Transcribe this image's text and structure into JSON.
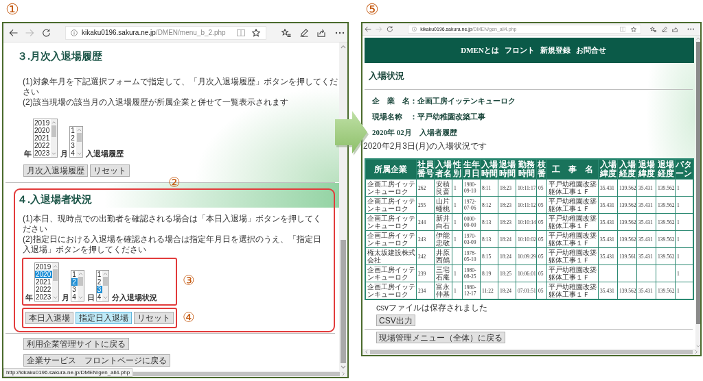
{
  "left_panel": {
    "marker": "①",
    "browser": {
      "nav_buttons": [
        {
          "kind": "back",
          "disabled": false
        },
        {
          "kind": "forward",
          "disabled": true
        },
        {
          "kind": "refresh",
          "disabled": false
        }
      ],
      "address": {
        "host": "kikaku0196.sakura.ne.jp",
        "path": "/DMEN/menu_b_2.php"
      },
      "status_url": "http://kikaku0196.sakura.ne.jp/DMEN/gen_all4.php"
    },
    "section_monthly": {
      "heading": "３.月次入退場履歴",
      "instructions": [
        "(1)対象年月を下記選択フォームで指定して、「月次入退場履歴」ボタンを押してください",
        "(2)該当現場の該当月の入退場履歴が所属企業と併せて一覧表示されます"
      ],
      "pickers": [
        {
          "label": "年",
          "options": [
            {
              "text": "2019",
              "selected": false
            },
            {
              "text": "2020",
              "selected": false
            },
            {
              "text": "2021",
              "selected": false
            },
            {
              "text": "2022",
              "selected": false
            },
            {
              "text": "2023",
              "selected": false
            }
          ]
        },
        {
          "label": "月",
          "options": [
            {
              "text": "1",
              "selected": false
            },
            {
              "text": "2",
              "selected": false
            },
            {
              "text": "3",
              "selected": false
            },
            {
              "text": "4",
              "selected": false
            }
          ]
        }
      ],
      "trailing_label": "入退場履歴",
      "buttons": [
        {
          "label": "月次入退場履歴",
          "hovered": false
        },
        {
          "label": "リセット",
          "hovered": false
        }
      ]
    },
    "section_marker": "②",
    "section_attendance": {
      "heading": "４.入退場者状況",
      "instructions": [
        "(1)本日、現時点での出勤者を確認される場合は「本日入退場」ボタンを押してください",
        "(2)指定日における入退場を確認される場合は指定年月日を選択のうえ、「指定日入退場」ボタンを押してください"
      ],
      "picker_marker": "③",
      "pickers": [
        {
          "label": "年",
          "options": [
            {
              "text": "2019",
              "selected": false
            },
            {
              "text": "2020",
              "selected": true
            },
            {
              "text": "2021",
              "selected": false
            },
            {
              "text": "2022",
              "selected": false
            },
            {
              "text": "2023",
              "selected": false
            }
          ]
        },
        {
          "label": "月",
          "options": [
            {
              "text": "1",
              "selected": false
            },
            {
              "text": "2",
              "selected": true
            },
            {
              "text": "3",
              "selected": false
            },
            {
              "text": "4",
              "selected": false
            }
          ]
        },
        {
          "label": "日",
          "options": [
            {
              "text": "1",
              "selected": false
            },
            {
              "text": "2",
              "selected": false
            },
            {
              "text": "3",
              "selected": true
            },
            {
              "text": "4",
              "selected": false
            }
          ]
        }
      ],
      "trailing_label": "分入退場状況",
      "button_marker": "④",
      "buttons": [
        {
          "label": "本日入退場",
          "hovered": false
        },
        {
          "label": "指定日入退場",
          "hovered": true
        },
        {
          "label": "リセット",
          "hovered": false
        }
      ]
    },
    "footer_buttons": [
      "利用企業管理サイトに戻る",
      "企業サービス　フロントページに戻る"
    ]
  },
  "right_panel": {
    "marker": "⑤",
    "browser": {
      "nav_buttons": [
        {
          "kind": "back",
          "disabled": false
        },
        {
          "kind": "forward",
          "disabled": true
        },
        {
          "kind": "refresh",
          "disabled": false
        }
      ],
      "address": {
        "host": "kikaku0196.sakura.ne.jp",
        "path": "/DMEN/gen_all4.php"
      }
    },
    "site_nav": [
      "DMENとは",
      "フロント",
      "新規登録",
      "お問合せ"
    ],
    "heading": "入場状況",
    "company_line": "企　業　名：企画工房イッテンキューロク",
    "site_line": "現場名称　：平戸幼稚園改築工事",
    "period_heading": "2020年 02月　入場者履歴",
    "date_note": "2020年2月3日(月)の入場状況です",
    "table": {
      "columns": [
        {
          "label": "所属企業",
          "kind": "text"
        },
        {
          "label": "社員番号",
          "kind": "number"
        },
        {
          "label": "入場者名",
          "kind": "text"
        },
        {
          "label": "性別",
          "kind": "number"
        },
        {
          "label": "生年月日",
          "kind": "number"
        },
        {
          "label": "入場時間",
          "kind": "number"
        },
        {
          "label": "退場時間",
          "kind": "number"
        },
        {
          "label": "勤務時間",
          "kind": "number"
        },
        {
          "label": "枝番",
          "kind": "number"
        },
        {
          "label": "工　事　名",
          "kind": "text"
        },
        {
          "label": "入場緯度",
          "kind": "number"
        },
        {
          "label": "入場経度",
          "kind": "number"
        },
        {
          "label": "退場緯度",
          "kind": "number"
        },
        {
          "label": "退場経度",
          "kind": "number"
        },
        {
          "label": "パターン",
          "kind": "number"
        }
      ],
      "rows": [
        [
          "企画工房イッテンキューロク",
          "262",
          "安積艮斎",
          "1",
          "1980-09-10",
          "8:11",
          "18:23",
          "10:11:17",
          "05",
          "平戸幼稚園改築躯体工事１Ｆ",
          "35.431",
          "139.562",
          "35.431",
          "139.562",
          "1"
        ],
        [
          "企画工房イッテンキューロク",
          "255",
          "山片蟠桃",
          "1",
          "1972-07-06",
          "8:12",
          "18:23",
          "10:11:12",
          "05",
          "平戸幼稚園改築躯体工事１Ｆ",
          "35.431",
          "139.562",
          "35.431",
          "139.562",
          "1"
        ],
        [
          "企画工房イッテンキューロク",
          "244",
          "新井白石",
          "1",
          "0000-00-00",
          "8:13",
          "18:23",
          "10:10:14",
          "05",
          "平戸幼稚園改築躯体工事１Ｆ",
          "35.431",
          "139.562",
          "35.431",
          "139.562",
          "1"
        ],
        [
          "企画工房イッテンキューロク",
          "243",
          "伊能忠敬",
          "1",
          "1970-03-09",
          "8:13",
          "18:24",
          "10:10:02",
          "05",
          "平戸幼稚園改築躯体工事１Ｆ",
          "35.431",
          "139.562",
          "35.431",
          "139.562",
          "1"
        ],
        [
          "権太坂建設株式会社",
          "242",
          "井原西鶴",
          null,
          "1978-05-10",
          "8:15",
          "18:24",
          "10:09:29",
          "05",
          "平戸幼稚園改築躯体工事１Ｆ",
          "35.431",
          "139.561",
          "35.431",
          "139.562",
          "1"
        ],
        [
          "企画工房イッテンキューロク",
          "239",
          "三宅石庵",
          "1",
          "1980-08-25",
          "8:19",
          "18:25",
          "10:06:01",
          "05",
          "平戸幼稚園改築躯体工事１Ｆ",
          null,
          null,
          null,
          null,
          "1"
        ],
        [
          "企画工房イッテンキューロク",
          "234",
          "富永仲基",
          "1",
          "1980-12-17",
          "11:22",
          "18:24",
          "07:01:51",
          "05",
          "平戸幼稚園改築躯体工事１Ｆ",
          "35.431",
          "139.562",
          "35.431",
          "139.562",
          "1"
        ]
      ]
    },
    "csv_note": "csvファイルは保存されました",
    "csv_button": "CSV出力",
    "back_button": "現場管理メニュー（全体）に戻る"
  }
}
